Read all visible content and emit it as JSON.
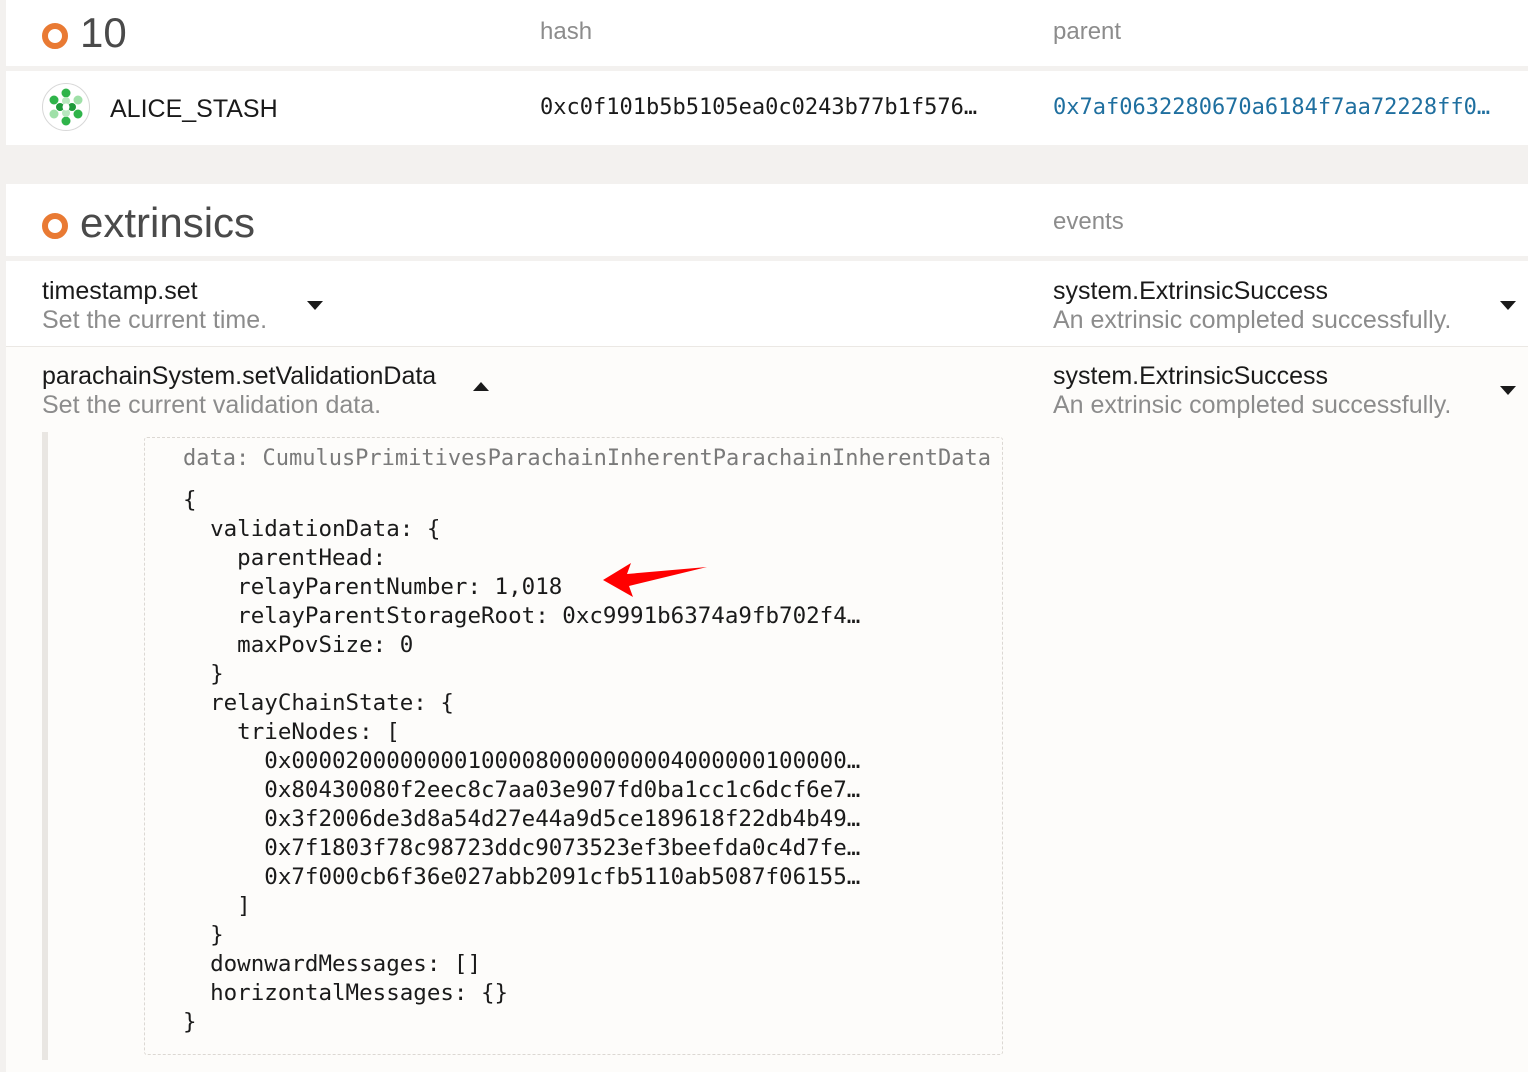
{
  "block": {
    "number": "10",
    "col_hash": "hash",
    "col_parent": "parent",
    "author": "ALICE_STASH",
    "hash": "0xc0f101b5b5105ea0c0243b77b1f576…",
    "parent": "0x7af0632280670a6184f7aa72228ff0…",
    "link_color": "#1f6f9f",
    "accent_color": "#e97a33"
  },
  "extrinsics": {
    "title": "extrinsics",
    "events_header": "events",
    "items": [
      {
        "call": "timestamp.set",
        "description": "Set the current time.",
        "event": "system.ExtrinsicSuccess",
        "event_description": "An extrinsic completed successfully.",
        "expanded": false
      },
      {
        "call": "parachainSystem.setValidationData",
        "description": "Set the current validation data.",
        "event": "system.ExtrinsicSuccess",
        "event_description": "An extrinsic completed successfully.",
        "expanded": true
      }
    ],
    "param": {
      "label": "data: CumulusPrimitivesParachainInherentParachainInherentData",
      "lines": [
        "{",
        "  validationData: {",
        "    parentHead:",
        "    relayParentNumber: 1,018",
        "    relayParentStorageRoot: 0xc9991b6374a9fb702f4…",
        "    maxPovSize: 0",
        "  }",
        "  relayChainState: {",
        "    trieNodes: [",
        "      0x00002000000001000080000000004000000100000…",
        "      0x80430080f2eec8c7aa03e907fd0ba1cc1c6dcf6e7…",
        "      0x3f2006de3d8a54d27e44a9d5ce189618f22db4b49…",
        "      0x7f1803f78c98723ddc9073523ef3beefda0c4d7fe…",
        "      0x7f000cb6f36e027abb2091cfb5110ab5087f06155…",
        "    ]",
        "  }",
        "  downwardMessages: []",
        "  horizontalMessages: {}",
        "}"
      ]
    },
    "annotation_arrow_color": "#ff0000"
  }
}
